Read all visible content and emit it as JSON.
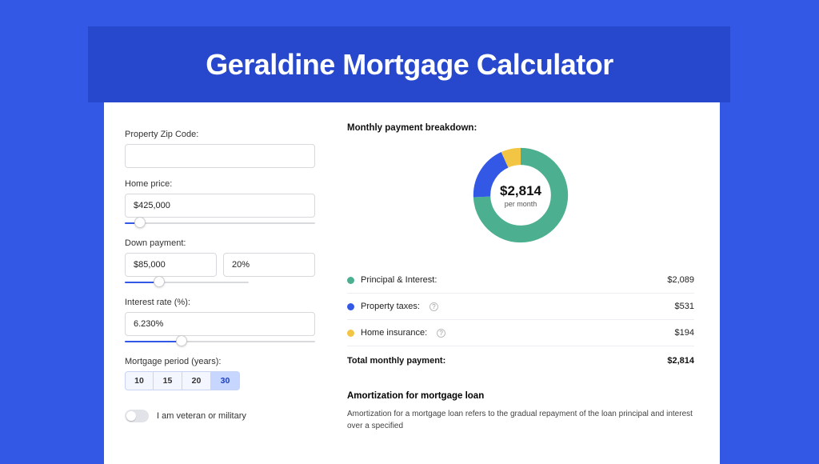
{
  "title": "Geraldine Mortgage Calculator",
  "colors": {
    "principal": "#4caf8f",
    "taxes": "#3358e6",
    "insurance": "#f3c544"
  },
  "form": {
    "zip_label": "Property Zip Code:",
    "zip_value": "",
    "home_price_label": "Home price:",
    "home_price_value": "$425,000",
    "down_payment_label": "Down payment:",
    "down_payment_value": "$85,000",
    "down_payment_pct": "20%",
    "interest_label": "Interest rate (%):",
    "interest_value": "6.230%",
    "period_label": "Mortgage period (years):",
    "periods": [
      "10",
      "15",
      "20",
      "30"
    ],
    "period_active": "30",
    "veteran_label": "I am veteran or military"
  },
  "breakdown": {
    "title": "Monthly payment breakdown:",
    "center_value": "$2,814",
    "center_sub": "per month",
    "rows": [
      {
        "label": "Principal & Interest:",
        "value": "$2,089",
        "info": false,
        "color_key": "principal"
      },
      {
        "label": "Property taxes:",
        "value": "$531",
        "info": true,
        "color_key": "taxes"
      },
      {
        "label": "Home insurance:",
        "value": "$194",
        "info": true,
        "color_key": "insurance"
      }
    ],
    "total_label": "Total monthly payment:",
    "total_value": "$2,814"
  },
  "chart_data": {
    "type": "pie",
    "title": "Monthly payment breakdown",
    "series": [
      {
        "name": "Principal & Interest",
        "value": 2089
      },
      {
        "name": "Property taxes",
        "value": 531
      },
      {
        "name": "Home insurance",
        "value": 194
      }
    ],
    "total": 2814,
    "units": "USD per month",
    "donut": true
  },
  "amortization": {
    "title": "Amortization for mortgage loan",
    "text": "Amortization for a mortgage loan refers to the gradual repayment of the loan principal and interest over a specified"
  }
}
